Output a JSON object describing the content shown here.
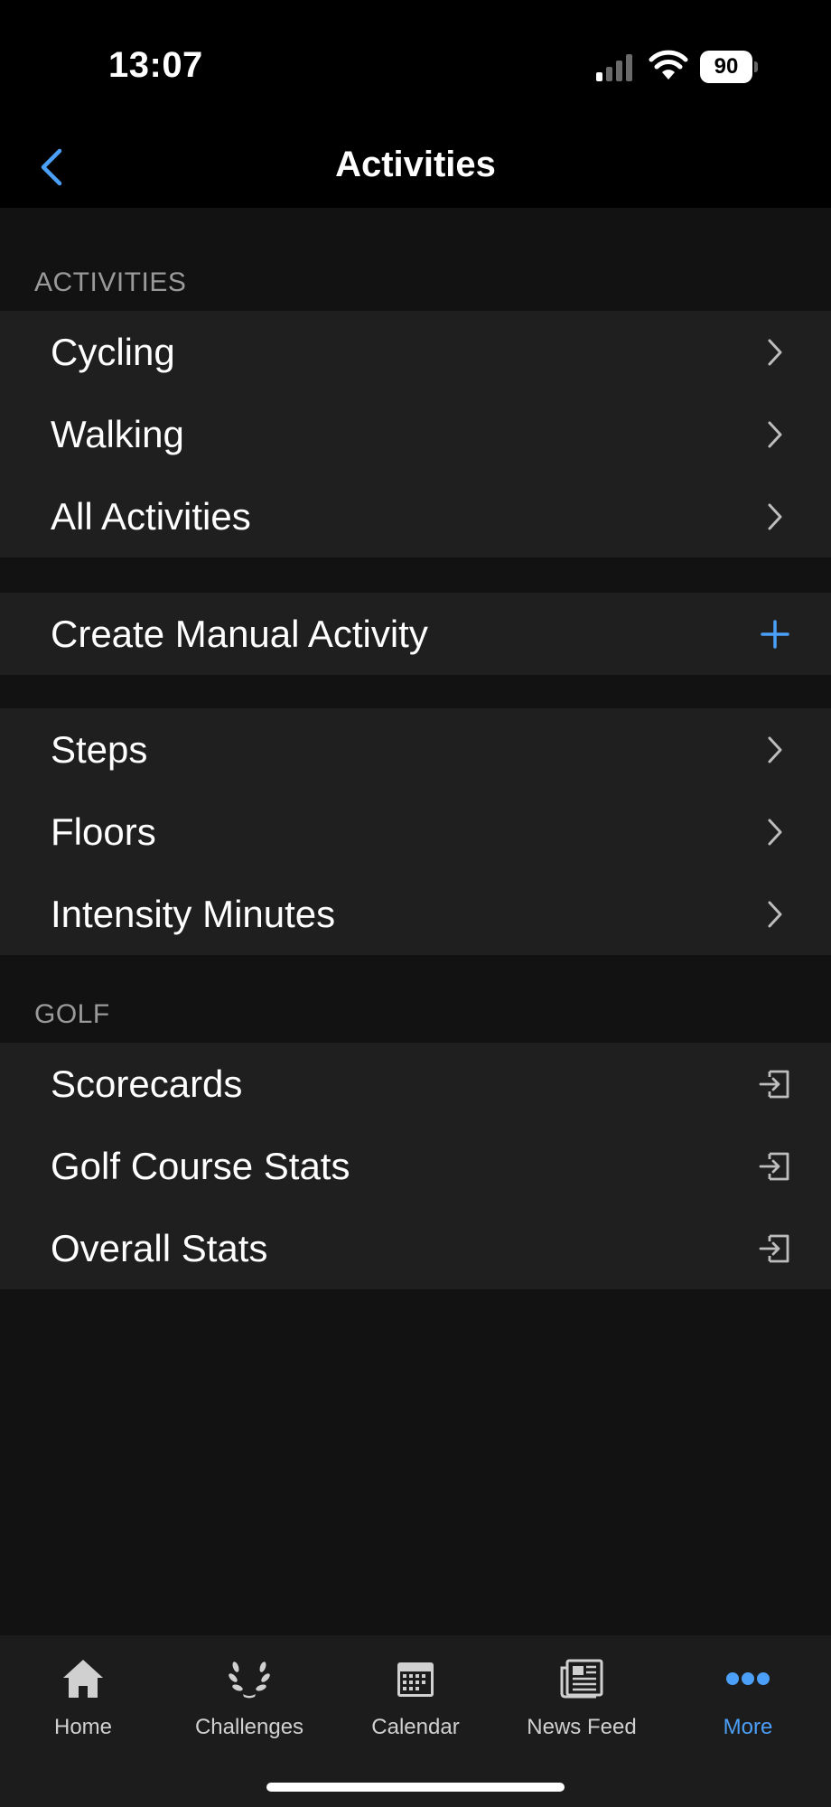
{
  "status": {
    "time": "13:07",
    "battery": "90"
  },
  "nav": {
    "title": "Activities",
    "back_icon": "chevron-left-icon"
  },
  "sections": {
    "activities": {
      "header": "ACTIVITIES",
      "items": [
        {
          "label": "Cycling",
          "icon": "chevron-right-icon"
        },
        {
          "label": "Walking",
          "icon": "chevron-right-icon"
        },
        {
          "label": "All Activities",
          "icon": "chevron-right-icon"
        }
      ]
    },
    "manual": {
      "items": [
        {
          "label": "Create Manual Activity",
          "icon": "plus-icon"
        }
      ]
    },
    "metrics": {
      "items": [
        {
          "label": "Steps",
          "icon": "chevron-right-icon"
        },
        {
          "label": "Floors",
          "icon": "chevron-right-icon"
        },
        {
          "label": "Intensity Minutes",
          "icon": "chevron-right-icon"
        }
      ]
    },
    "golf": {
      "header": "GOLF",
      "items": [
        {
          "label": "Scorecards",
          "icon": "external-link-icon"
        },
        {
          "label": "Golf Course Stats",
          "icon": "external-link-icon"
        },
        {
          "label": "Overall Stats",
          "icon": "external-link-icon"
        }
      ]
    }
  },
  "tabbar": {
    "tabs": [
      {
        "label": "Home",
        "icon": "home-icon"
      },
      {
        "label": "Challenges",
        "icon": "laurel-icon"
      },
      {
        "label": "Calendar",
        "icon": "calendar-icon"
      },
      {
        "label": "News Feed",
        "icon": "newspaper-icon"
      },
      {
        "label": "More",
        "icon": "more-dots-icon",
        "active": true
      }
    ]
  },
  "colors": {
    "accent": "#4c9ff7",
    "background": "#121212",
    "row": "#1f1f1f",
    "header_text": "#9a9a9a"
  }
}
